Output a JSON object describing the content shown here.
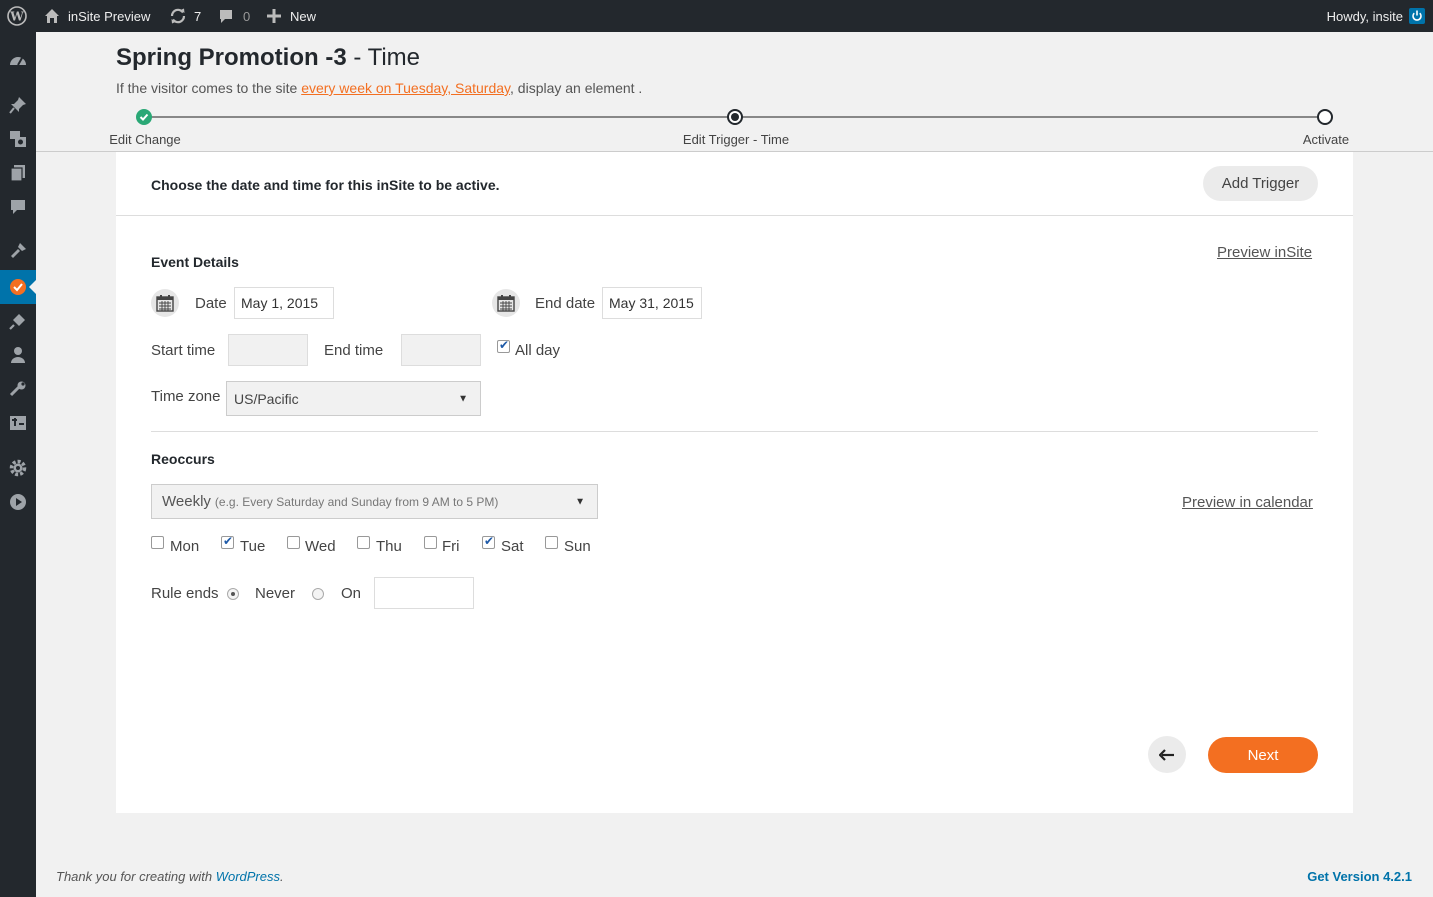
{
  "adminbar": {
    "site_name": "inSite Preview",
    "updates_count": "7",
    "comments_count": "0",
    "new_label": "New",
    "howdy": "Howdy, insite"
  },
  "header": {
    "title_bold": "Spring Promotion -3",
    "title_rest": " - Time",
    "summary_before": "If the visitor comes to the site ",
    "summary_link": "every week on Tuesday, Saturday",
    "summary_after": ", display an element ."
  },
  "steps": [
    {
      "label": "Edit Change",
      "state": "done"
    },
    {
      "label": "Edit Trigger - Time",
      "state": "current"
    },
    {
      "label": "Activate",
      "state": "pending"
    }
  ],
  "panel": {
    "intro": "Choose the date and time for this inSite to be active.",
    "add_trigger": "Add Trigger",
    "event_details": "Event Details",
    "preview_insite": "Preview inSite",
    "date_label": "Date",
    "date_value": "May 1, 2015",
    "end_date_label": "End date",
    "end_date_value": "May 31, 2015",
    "start_time_label": "Start time",
    "start_time_value": "",
    "end_time_label": "End time",
    "end_time_value": "",
    "all_day_label": "All day",
    "all_day_checked": true,
    "time_zone_label": "Time zone",
    "time_zone_value": "US/Pacific",
    "reoccurs": "Reoccurs",
    "frequency_value": "Weekly",
    "frequency_hint": "(e.g. Every Saturday and Sunday from 9 AM to 5 PM)",
    "preview_calendar": "Preview in calendar",
    "days": [
      {
        "label": "Mon",
        "checked": false
      },
      {
        "label": "Tue",
        "checked": true
      },
      {
        "label": "Wed",
        "checked": false
      },
      {
        "label": "Thu",
        "checked": false
      },
      {
        "label": "Fri",
        "checked": false
      },
      {
        "label": "Sat",
        "checked": true
      },
      {
        "label": "Sun",
        "checked": false
      }
    ],
    "rule_ends_label": "Rule ends",
    "never_label": "Never",
    "on_label": "On",
    "on_value": "",
    "next_label": "Next"
  },
  "footer": {
    "thanks_before": "Thank you for creating with ",
    "thanks_link": "WordPress",
    "thanks_after": ".",
    "version": "Get Version 4.2.1"
  },
  "colors": {
    "accent": "#f36f21",
    "done": "#2aa876",
    "wp_blue": "#0073aa",
    "adminbar": "#23282d"
  },
  "icons": {
    "adminbar": [
      "wordpress-icon",
      "home-icon",
      "updates-icon",
      "comments-icon",
      "plus-icon",
      "power-icon"
    ],
    "sidebar": [
      "dashboard-icon",
      "pin-icon",
      "media-icon",
      "pages-icon",
      "comments-icon",
      "appearance-icon",
      "insite-icon",
      "plugins-icon",
      "users-icon",
      "tools-icon",
      "settings-icon",
      "gear-icon",
      "play-icon"
    ]
  }
}
